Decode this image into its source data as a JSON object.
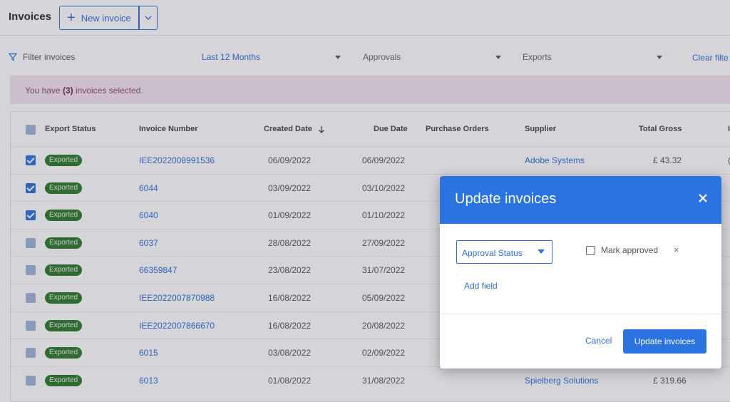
{
  "header": {
    "title": "Invoices",
    "new_invoice_label": "New invoice"
  },
  "filters": {
    "label": "Filter invoices",
    "date_range": "Last 12 Months",
    "approvals": "Approvals",
    "exports": "Exports",
    "clear": "Clear filte"
  },
  "selection": {
    "prefix": "You have ",
    "count": "(3)",
    "suffix": " invoices selected."
  },
  "table": {
    "columns": {
      "export_status": "Export Status",
      "invoice_number": "Invoice Number",
      "created_date": "Created Date",
      "due_date": "Due Date",
      "purchase_orders": "Purchase Orders",
      "supplier": "Supplier",
      "total_gross": "Total Gross",
      "extra": "I"
    },
    "rows": [
      {
        "checked": true,
        "status": "Exported",
        "invoice": "IEE2022008991536",
        "created": "06/09/2022",
        "due": "06/09/2022",
        "supplier": "Adobe Systems",
        "total": "£ 43.32",
        "extra": "("
      },
      {
        "checked": true,
        "status": "Exported",
        "invoice": "6044",
        "created": "03/09/2022",
        "due": "03/10/2022",
        "supplier": "",
        "total": "",
        "extra": ""
      },
      {
        "checked": true,
        "status": "Exported",
        "invoice": "6040",
        "created": "01/09/2022",
        "due": "01/10/2022",
        "supplier": "",
        "total": "",
        "extra": ""
      },
      {
        "checked": false,
        "status": "Exported",
        "invoice": "6037",
        "created": "28/08/2022",
        "due": "27/09/2022",
        "supplier": "",
        "total": "",
        "extra": ""
      },
      {
        "checked": false,
        "status": "Exported",
        "invoice": "66359847",
        "created": "23/08/2022",
        "due": "31/07/2022",
        "supplier": "",
        "total": "",
        "extra": ""
      },
      {
        "checked": false,
        "status": "Exported",
        "invoice": "IEE2022007870988",
        "created": "16/08/2022",
        "due": "05/09/2022",
        "supplier": "",
        "total": "",
        "extra": ""
      },
      {
        "checked": false,
        "status": "Exported",
        "invoice": "IEE2022007866670",
        "created": "16/08/2022",
        "due": "20/08/2022",
        "supplier": "",
        "total": "",
        "extra": ""
      },
      {
        "checked": false,
        "status": "Exported",
        "invoice": "6015",
        "created": "03/08/2022",
        "due": "02/09/2022",
        "supplier": "",
        "total": "",
        "extra": ""
      },
      {
        "checked": false,
        "status": "Exported",
        "invoice": "6013",
        "created": "01/08/2022",
        "due": "31/08/2022",
        "supplier": "Spielberg Solutions",
        "total": "£ 319.66",
        "extra": ""
      }
    ]
  },
  "modal": {
    "title": "Update invoices",
    "field_select": "Approval Status",
    "mark_approved": "Mark approved",
    "remove_symbol": "×",
    "add_field": "Add field",
    "cancel": "Cancel",
    "submit": "Update invoices"
  },
  "colors": {
    "accent": "#2b73e1",
    "exported_badge": "#2d7a2a",
    "banner": "#f4e4ee"
  }
}
